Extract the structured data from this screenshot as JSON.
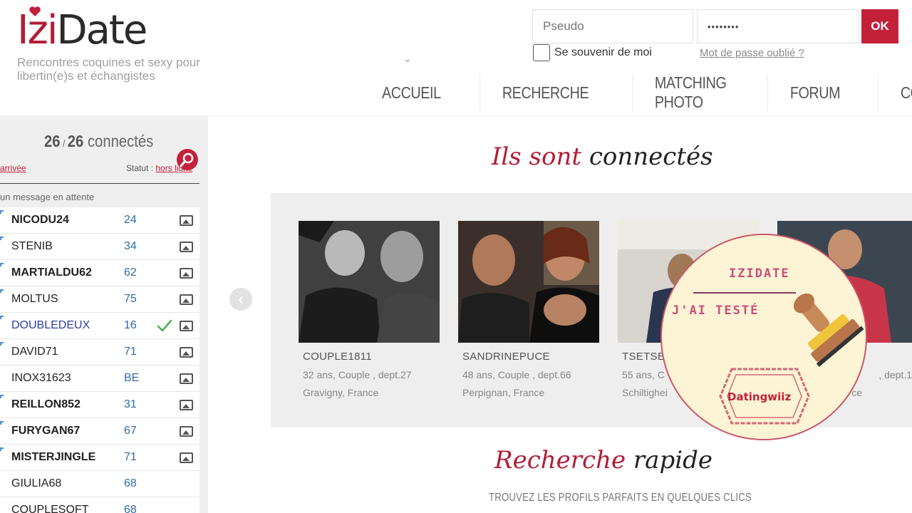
{
  "brand": {
    "logo_part1": "Izi",
    "logo_part2": "Date",
    "tagline": "Rencontres coquines et sexy pour libertin(e)s et échangistes"
  },
  "login": {
    "pseudo_placeholder": "Pseudo",
    "password_value": "••••••••",
    "ok_label": "OK",
    "remember_label": "Se souvenir de moi",
    "forgot_label": "Mot de passe oublié ?"
  },
  "nav": {
    "items": [
      "ACCUEIL",
      "RECHERCHE",
      "MATCHING PHOTO",
      "FORUM",
      "CONTACT"
    ]
  },
  "sidebar": {
    "connected_count": "26",
    "connected_total": "26",
    "connected_label": "connectés",
    "arrivee_label": "arrivée",
    "statut_label": "Statut :",
    "statut_value": "hors ligne",
    "waiting_label": "un message en attente",
    "users": [
      {
        "name": "NICODU24",
        "age": "24",
        "bold": true,
        "photo": true,
        "check": false,
        "blue": false
      },
      {
        "name": "STENIB",
        "age": "34",
        "bold": false,
        "photo": true,
        "check": false,
        "blue": false
      },
      {
        "name": "MARTIALDU62",
        "age": "62",
        "bold": true,
        "photo": true,
        "check": false,
        "blue": false
      },
      {
        "name": "MOLTUS",
        "age": "75",
        "bold": false,
        "photo": true,
        "check": false,
        "blue": false
      },
      {
        "name": "DOUBLEDEUX",
        "age": "16",
        "bold": false,
        "photo": true,
        "check": true,
        "blue": true
      },
      {
        "name": "DAVID71",
        "age": "71",
        "bold": false,
        "photo": true,
        "check": false,
        "blue": false
      },
      {
        "name": "INOX31623",
        "age": "BE",
        "bold": false,
        "photo": true,
        "check": false,
        "blue": false
      },
      {
        "name": "REILLON852",
        "age": "31",
        "bold": true,
        "photo": true,
        "check": false,
        "blue": false
      },
      {
        "name": "FURYGAN67",
        "age": "67",
        "bold": true,
        "photo": true,
        "check": false,
        "blue": false
      },
      {
        "name": "MISTERJINGLE",
        "age": "71",
        "bold": true,
        "photo": true,
        "check": false,
        "blue": false
      },
      {
        "name": "GIULIA68",
        "age": "68",
        "bold": false,
        "photo": false,
        "check": false,
        "blue": false
      },
      {
        "name": "COUPLESOFT",
        "age": "68",
        "bold": false,
        "photo": false,
        "check": false,
        "blue": false
      }
    ]
  },
  "main": {
    "connected_title_accent": "Ils sont",
    "connected_title_rest": "connectés",
    "cards": [
      {
        "name": "COUPLE1811",
        "info": "32 ans, Couple , dept.27",
        "location": "Gravigny, France"
      },
      {
        "name": "SANDRINEPUCE",
        "info": "48 ans, Couple , dept.66",
        "location": "Perpignan, France"
      },
      {
        "name": "TSETSE",
        "info": "55 ans, C",
        "location": "Schiltighei"
      },
      {
        "name": "",
        "info": ", dept.1",
        "location": "ce"
      }
    ],
    "search_title_accent": "Recherche",
    "search_title_rest": "rapide",
    "search_subtitle": "TROUVEZ LES PROFILS PARFAITS EN QUELQUES CLICS"
  },
  "badge": {
    "title": "IZIDATE",
    "subtitle": "J'AI TESTÉ",
    "stamp_text": "Datingwiiz"
  },
  "colors": {
    "accent": "#c3213a",
    "brand_red": "#b01e36",
    "badge_bg": "#fdf3d5"
  }
}
